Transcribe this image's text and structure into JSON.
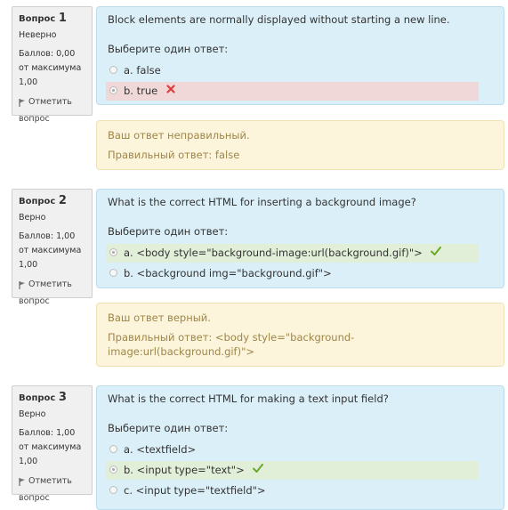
{
  "questions": [
    {
      "label": "Вопрос",
      "number": "1",
      "state": "Неверно",
      "grade": "Баллов: 0,00 от максимума 1,00",
      "flag_label": "Отметить вопрос",
      "text": "Block elements are normally displayed without starting a new line.",
      "prompt": "Выберите один ответ:",
      "answers": [
        {
          "label": "a. false",
          "checked": false,
          "mark": ""
        },
        {
          "label": "b. true",
          "checked": true,
          "mark": "incorrect"
        }
      ],
      "feedback": "Ваш ответ неправильный.",
      "right_answer": "Правильный ответ: false"
    },
    {
      "label": "Вопрос",
      "number": "2",
      "state": "Верно",
      "grade": "Баллов: 1,00 от максимума 1,00",
      "flag_label": "Отметить вопрос",
      "text": "What is the correct HTML for inserting a background image?",
      "prompt": "Выберите один ответ:",
      "answers": [
        {
          "label": "a. <body style=\"background-image:url(background.gif)\">",
          "checked": true,
          "mark": "correct"
        },
        {
          "label": "b. <background img=\"background.gif\">",
          "checked": false,
          "mark": ""
        }
      ],
      "feedback": "Ваш ответ верный.",
      "right_answer": "Правильный ответ: <body style=\"background-image:url(background.gif)\">"
    },
    {
      "label": "Вопрос",
      "number": "3",
      "state": "Верно",
      "grade": "Баллов: 1,00 от максимума 1,00",
      "flag_label": "Отметить вопрос",
      "text": "What is the correct HTML for making a text input field?",
      "prompt": "Выберите один ответ:",
      "answers": [
        {
          "label": "a. <textfield>",
          "checked": false,
          "mark": ""
        },
        {
          "label": "b. <input type=\"text\">",
          "checked": true,
          "mark": "correct"
        },
        {
          "label": "c. <input type=\"textfield\">",
          "checked": false,
          "mark": ""
        }
      ]
    }
  ],
  "colors": {
    "formulation_bg": "#dbeff8",
    "outcome_bg": "#fcf5dc",
    "incorrect_bg": "#f1d8d8",
    "correct_bg": "#e1efd9",
    "incorrect_mark": "#e03c3c",
    "correct_mark": "#6aa82e"
  }
}
